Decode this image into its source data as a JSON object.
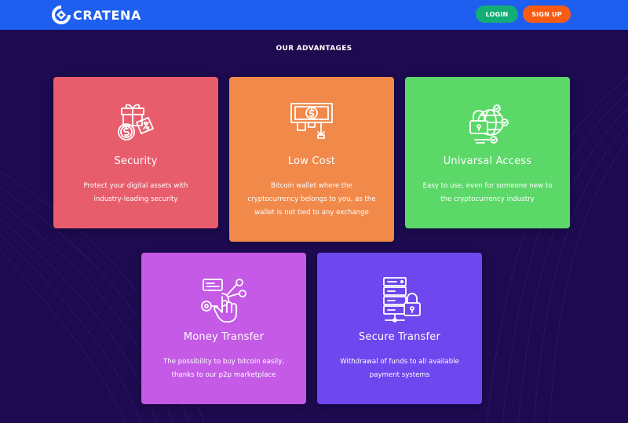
{
  "header": {
    "brand": "CRATENA",
    "login_label": "LOGIN",
    "signup_label": "SIGN UP"
  },
  "advantages": {
    "title": "OUR ADVANTAGES",
    "cards": [
      {
        "icon": "gift-coin-icon",
        "title": "Security",
        "text_lines": [
          "Protect your digital assets with",
          "industry-leading security"
        ],
        "color": "#e75d6c"
      },
      {
        "icon": "cash-withdrawal-icon",
        "title": "Low Cost",
        "text_lines": [
          "Bitcoin wallet where the",
          "cryptocurrency belongs to you, as the",
          "wallet is not tied to any exchange"
        ],
        "color": "#f0894a"
      },
      {
        "icon": "global-lock-icon",
        "title": "Univarsal Access",
        "text_lines": [
          "Easy to use, even for someone new to",
          "the cryptocurrency industry"
        ],
        "color": "#5bd868"
      },
      {
        "icon": "touch-network-icon",
        "title": "Money Transfer",
        "text_lines": [
          "The possibility to buy bitcoin easily,",
          "thanks to our p2p marketplace"
        ],
        "color": "#c45ae6"
      },
      {
        "icon": "server-lock-icon",
        "title": "Secure Transfer",
        "text_lines": [
          "Withdrawal of funds to all available",
          "payment systems"
        ],
        "color": "#6e47ee"
      }
    ]
  },
  "colors": {
    "header": "#1f5ff0",
    "background": "#1d0a4f",
    "login_button": "#13ad76",
    "signup_button": "#fa5b13"
  }
}
